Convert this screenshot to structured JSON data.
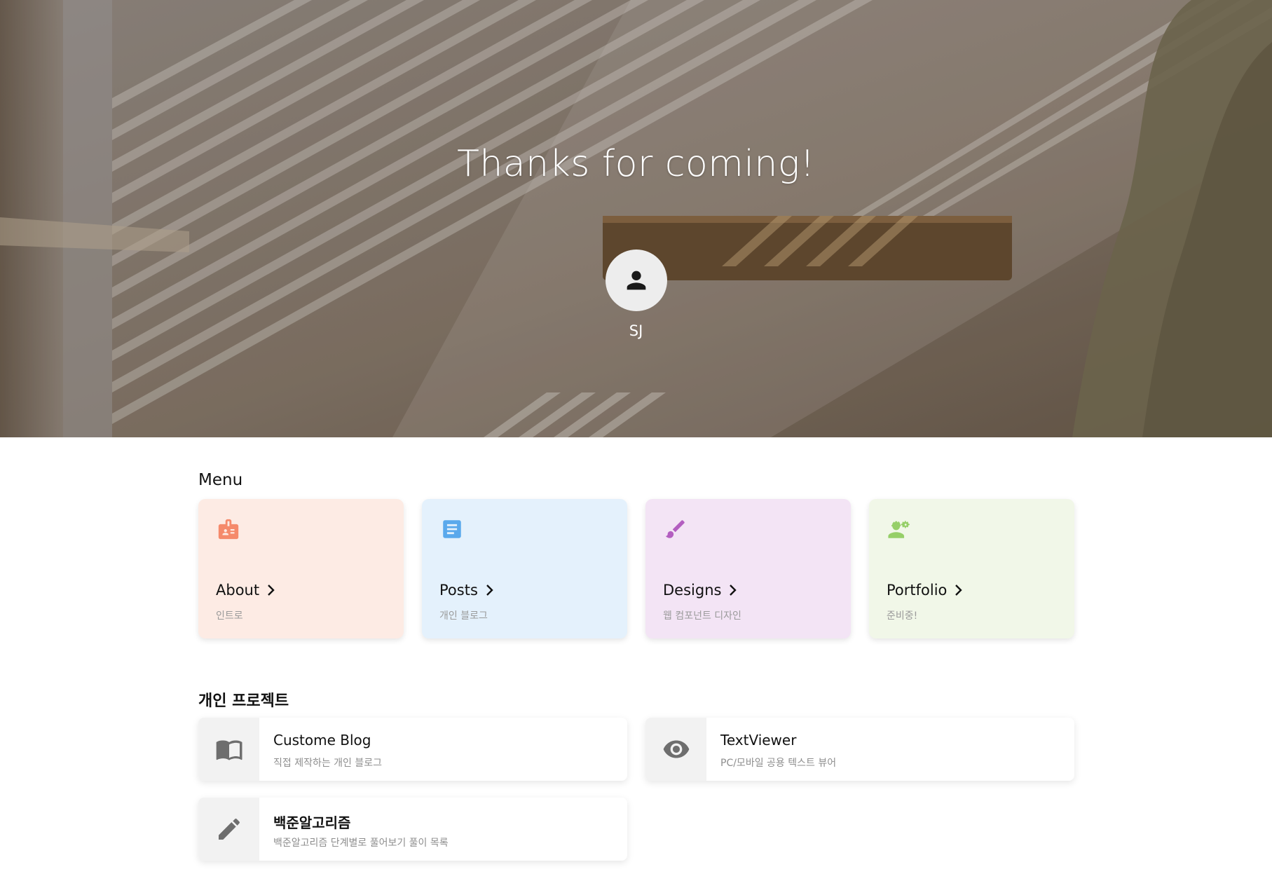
{
  "hero": {
    "title": "Thanks for coming!",
    "avatar_icon": "person-icon",
    "name": "SJ"
  },
  "menu": {
    "title": "Menu",
    "items": [
      {
        "label": "About",
        "sub": "인트로",
        "icon": "id-badge-icon",
        "bg": "#fdebe4",
        "icon_color": "#f58a6b"
      },
      {
        "label": "Posts",
        "sub": "개인 블로그",
        "icon": "document-icon",
        "bg": "#e4f1fc",
        "icon_color": "#5aa9ec"
      },
      {
        "label": "Designs",
        "sub": "웹 컴포넌트 디자인",
        "icon": "brush-icon",
        "bg": "#f3e4f5",
        "icon_color": "#b35ec0"
      },
      {
        "label": "Portfolio",
        "sub": "준비중!",
        "icon": "engineer-icon",
        "bg": "#f1f7e8",
        "icon_color": "#96cf68"
      }
    ]
  },
  "projects": {
    "title": "개인 프로젝트",
    "items": [
      {
        "label": "Custome Blog",
        "sub": "직접 제작하는 개인 블로그",
        "icon": "book-icon"
      },
      {
        "label": "TextViewer",
        "sub": "PC/모바일 공용 텍스트 뷰어",
        "icon": "eye-icon"
      },
      {
        "label": "백준알고리즘",
        "sub": "백준알고리즘 단계별로 풀어보기 풀이 목록",
        "icon": "pencil-icon"
      }
    ]
  },
  "colors": {
    "hero_overlay": "#857667",
    "icon_gray": "#6e6e6e"
  }
}
